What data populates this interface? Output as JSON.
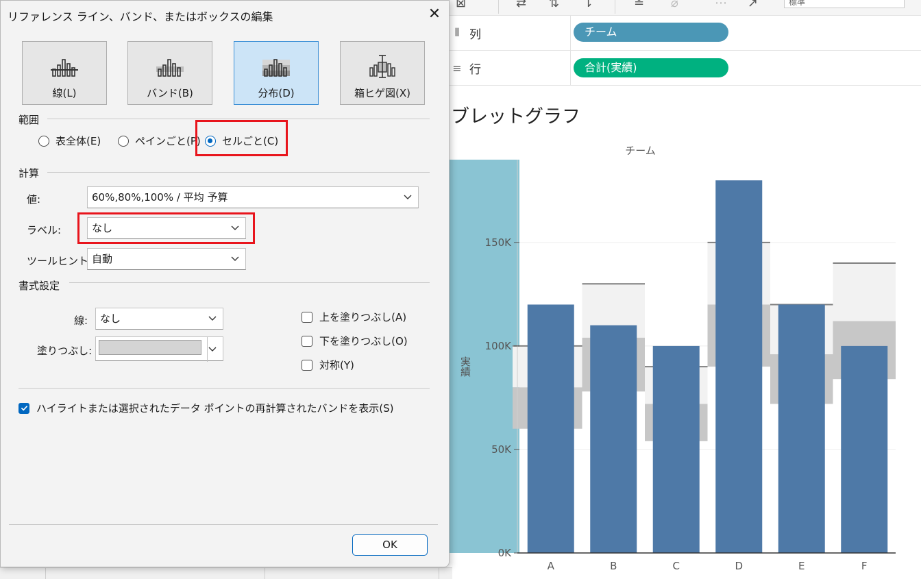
{
  "dialog": {
    "title": "リファレンス ライン、バンド、またはボックスの編集",
    "type_buttons": [
      {
        "label": "線(L)",
        "icon": "line-chart-icon",
        "selected": false
      },
      {
        "label": "バンド(B)",
        "icon": "band-chart-icon",
        "selected": false
      },
      {
        "label": "分布(D)",
        "icon": "distribution-chart-icon",
        "selected": true
      },
      {
        "label": "箱ヒゲ図(X)",
        "icon": "box-plot-icon",
        "selected": false
      }
    ],
    "scope": {
      "heading": "範囲",
      "options": [
        {
          "label": "表全体(E)",
          "checked": false
        },
        {
          "label": "ペインごと(P)",
          "checked": false
        },
        {
          "label": "セルごと(C)",
          "checked": true
        }
      ]
    },
    "calc": {
      "heading": "計算",
      "value_label": "値:",
      "value": "60%,80%,100% / 平均 予算",
      "label_label": "ラベル:",
      "label_value": "なし",
      "tooltip_label": "ツールヒント:",
      "tooltip_value": "自動"
    },
    "format": {
      "heading": "書式設定",
      "line_label": "線:",
      "line_value": "なし",
      "fill_label": "塗りつぶし:",
      "fill_color": "#d4d4d4",
      "fill_above": {
        "label": "上を塗りつぶし(A)",
        "checked": false
      },
      "fill_below": {
        "label": "下を塗りつぶし(O)",
        "checked": false
      },
      "symmetric": {
        "label": "対称(Y)",
        "checked": false
      }
    },
    "show_recalc": {
      "label": "ハイライトまたは選択されたデータ ポイントの再計算されたバンドを表示(S)",
      "checked": true
    },
    "ok_label": "OK"
  },
  "workspace": {
    "toolbar_dropdown": "標準",
    "columns_shelf": {
      "label": "列",
      "pill": "チーム",
      "pill_color": "#4b97b6"
    },
    "rows_shelf": {
      "label": "行",
      "pill": "合計(実績)",
      "pill_color": "#00b180"
    },
    "sheet_title": "ブレットグラフ"
  },
  "chart_data": {
    "type": "bar",
    "title": "ブレットグラフ",
    "header": "チーム",
    "ylabel": "実績",
    "xlabel": "",
    "ylim": [
      0,
      190000
    ],
    "yticks": [
      0,
      50000,
      100000,
      150000
    ],
    "ytick_labels": [
      "0K",
      "50K",
      "100K",
      "150K"
    ],
    "categories": [
      "A",
      "B",
      "C",
      "D",
      "E",
      "F"
    ],
    "series": [
      {
        "name": "実績",
        "values": [
          120000,
          110000,
          100000,
          180000,
          120000,
          100000
        ],
        "color": "#4e79a7"
      }
    ],
    "reference": {
      "budget": [
        100000,
        130000,
        90000,
        150000,
        120000,
        140000
      ],
      "band_percentages": [
        0.6,
        0.8,
        1.0
      ],
      "band_colors": [
        "#c7c7c7",
        "#e6e6e6",
        "#f2f2f2"
      ],
      "line_color": "#7f7f7f"
    },
    "highlight_color": "#8ac4d3",
    "grid": true
  }
}
